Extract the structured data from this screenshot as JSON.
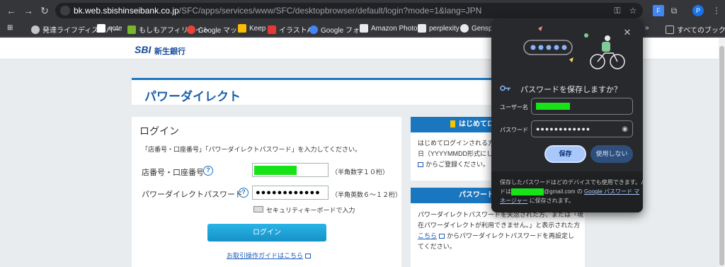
{
  "browser": {
    "url_host": "bk.web.sbishinseibank.co.jp",
    "url_path": "/SFC/apps/services/www/SFC/desktopbrowser/default/login?mode=1&lang=JPN",
    "profile_initial": "P"
  },
  "bookmarks": {
    "items": [
      {
        "label": "発達ライフディスカバー",
        "color": "#c4c7c5"
      },
      {
        "label": "note",
        "color": "#ffffff"
      },
      {
        "label": "もしもアフィリエイト",
        "color": "#77b82a"
      },
      {
        "label": "Google マップ",
        "color": "#ea4335"
      },
      {
        "label": "Keep",
        "color": "#fbbc04"
      },
      {
        "label": "イラストAC",
        "color": "#e53935"
      },
      {
        "label": "Google フォト",
        "color": "#4285f4"
      },
      {
        "label": "Amazon Photos",
        "color": "#e8eaed"
      },
      {
        "label": "perplexity",
        "color": "#e8eaed"
      },
      {
        "label": "Genspar",
        "color": "#e8eaed"
      }
    ],
    "overflow": "»",
    "all_bookmarks": "すべてのブックマーク"
  },
  "site": {
    "logo_mark": "SBI",
    "logo_name": "新生銀行",
    "page_title": "パワーダイレクト"
  },
  "login": {
    "title": "ログイン",
    "description": "「店番号・口座番号」「パワーダイレクトパスワード」を入力してください。",
    "account_label": "店番号・口座番号",
    "account_note": "（半角数字１０桁）",
    "password_label": "パワーダイレクトパスワード",
    "password_value": "●●●●●●●●●●●●",
    "password_note": "（半角英数６～１２桁）",
    "keyboard_label": "セキュリティキーボードで入力",
    "login_button": "ログイン",
    "guide_link": "お取引操作ガイドはこちら"
  },
  "side": {
    "first_time_head": "はじめてロ",
    "first_time_lines": [
      "はじめてログインされる方",
      "日（YYYYMMDD形式にし",
      "からご登録ください。"
    ],
    "password_head": "パスワード",
    "password_lines": [
      "パワーダイレクトパスワードを失念された方、または「現",
      "在パワーダイレクトが利用できません。」と表示された方",
      "からパワーダイレクトパスワードを再設定し",
      "てください。"
    ],
    "kochira": "こちら"
  },
  "save_password_popup": {
    "title": "パスワードを保存しますか？",
    "username_label": "ユーザー名",
    "password_label": "パスワード",
    "password_value": "●●●●●●●●●●●●",
    "save_button": "保存",
    "never_button": "使用しない",
    "footer_line1": "保存したパスワードはどのデバイスでも使用できます。パスワー",
    "footer_line2_prefix": "ドは",
    "footer_email_suffix": "@gmail.com の",
    "footer_link": "Google パスワード マ",
    "footer_line3_link": "ネージャー",
    "footer_line3_suffix": "に保存されます。"
  },
  "colors": {
    "accent_blue": "#1b76c0",
    "redaction_green": "#18e318",
    "popup_bg": "#28292c",
    "save_button": "#a8c7fa"
  }
}
